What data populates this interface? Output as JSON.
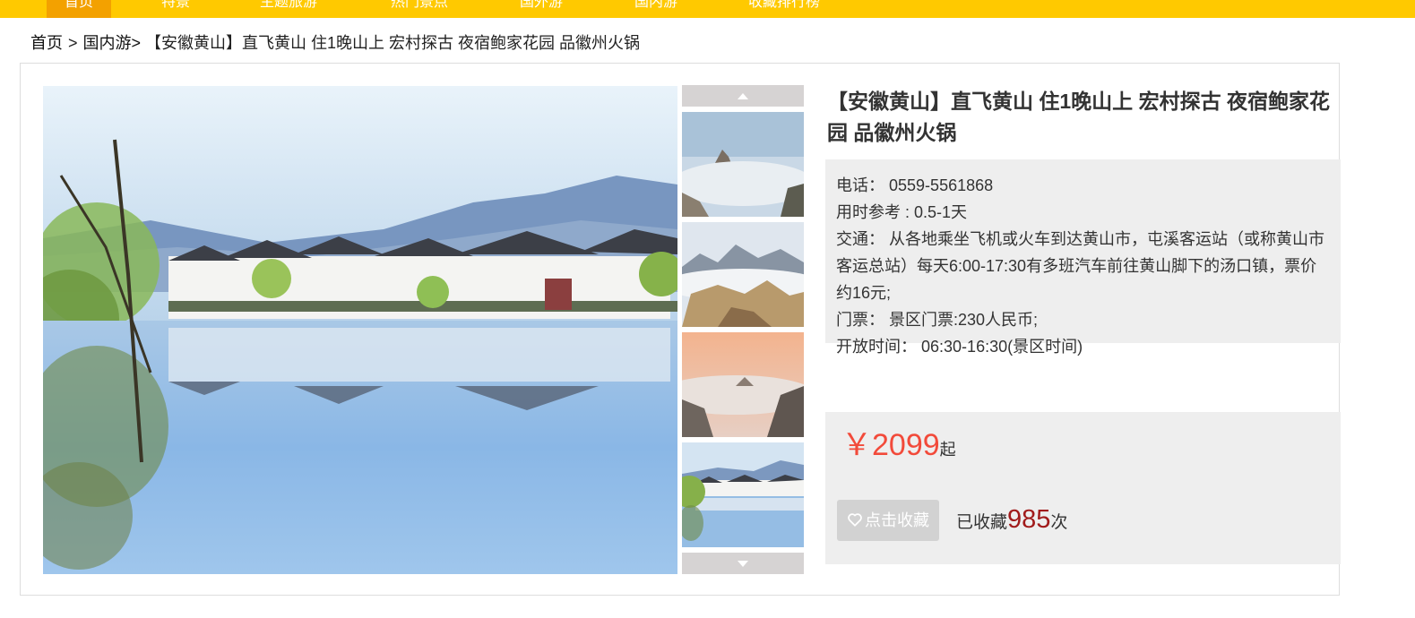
{
  "nav": {
    "items": [
      "首页",
      "特景",
      "主题旅游",
      "热门景点",
      "国外游",
      "国内游",
      "收藏排行榜"
    ],
    "active_index": 0
  },
  "breadcrumb": {
    "home": "首页",
    "separator": ">",
    "category": "国内游>",
    "current": "【安徽黄山】直飞黄山 住1晚山上 宏村探古 夜宿鲍家花园 品徽州火锅"
  },
  "product": {
    "title": "【安徽黄山】直飞黄山 住1晚山上 宏村探古 夜宿鲍家花园 品徽州火锅",
    "phone_label": "电话：",
    "phone": "0559-5561868",
    "duration_label": "用时参考 :",
    "duration": "0.5-1天",
    "traffic_label": "交通：",
    "traffic": "从各地乘坐飞机或火车到达黄山市，屯溪客运站（或称黄山市客运总站）每天6:00-17:30有多班汽车前往黄山脚下的汤口镇，票价约16元;",
    "ticket_label": "门票：",
    "ticket": "景区门票:230人民币;",
    "hours_label": "开放时间：",
    "hours": "06:30-16:30(景区时间)",
    "price_symbol": "￥",
    "price": "2099",
    "price_suffix": "起",
    "fav_button": "点击收藏",
    "fav_prefix": "已收藏",
    "fav_count": "985",
    "fav_suffix": "次"
  },
  "gallery": {
    "main_image": "hongcun-village-lake-photo",
    "thumbnails": [
      "huangshan-sea-of-clouds",
      "huangshan-peaks",
      "huangshan-sunrise-clouds",
      "hongcun-village-lake"
    ]
  },
  "colors": {
    "nav_bg": "#ffc900",
    "nav_active": "#f3a100",
    "price": "#f24a3a",
    "fav_count": "#a11b1b"
  }
}
